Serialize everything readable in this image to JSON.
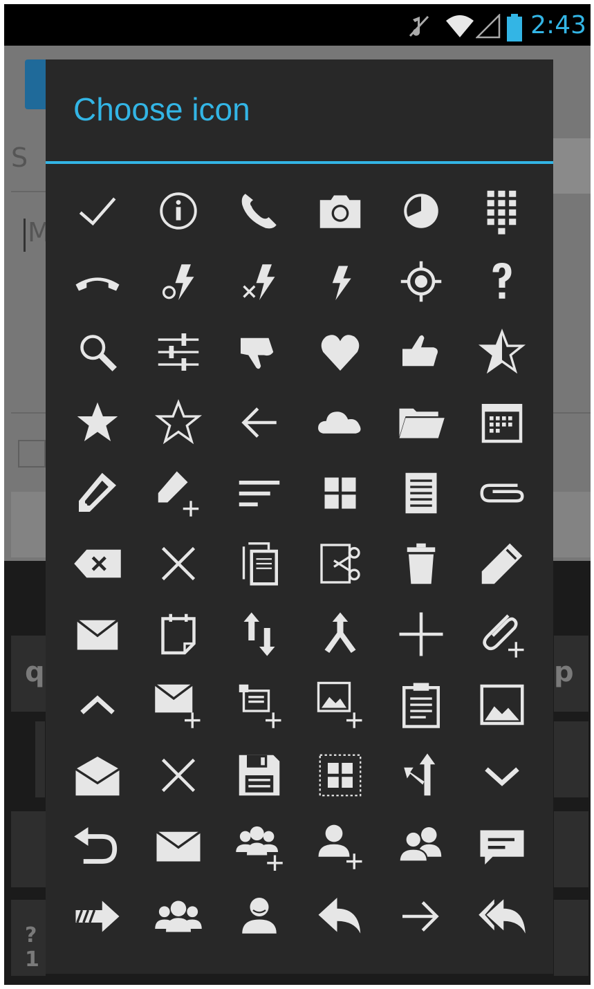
{
  "status_bar": {
    "time": "2:43",
    "icons": [
      "mute-icon",
      "wifi-icon",
      "signal-icon",
      "battery-icon"
    ],
    "accent_color": "#33b5e5"
  },
  "background_app": {
    "search_hint_letter": "S",
    "field_letter": "M",
    "keyboard_keys": [
      "q",
      "p",
      "?1"
    ]
  },
  "dialog": {
    "title": "Choose icon",
    "title_color": "#33b5e5",
    "background": "#282828",
    "icons": [
      "checkmark-icon",
      "info-icon",
      "phone-icon",
      "camera-icon",
      "clock-icon",
      "dialpad-icon",
      "end-call-icon",
      "flash-auto-icon",
      "flash-off-icon",
      "flash-icon",
      "locate-icon",
      "help-icon",
      "search-icon",
      "settings-sliders-icon",
      "thumbs-down-icon",
      "heart-icon",
      "thumbs-up-icon",
      "half-star-icon",
      "star-filled-icon",
      "star-outline-icon",
      "back-arrow-icon",
      "cloud-icon",
      "folder-icon",
      "calendar-icon",
      "label-icon",
      "add-label-icon",
      "sort-icon",
      "grid-view-icon",
      "document-icon",
      "attachment-icon",
      "backspace-icon",
      "close-icon",
      "copy-icon",
      "cut-icon",
      "trash-icon",
      "edit-icon",
      "email-icon",
      "new-event-icon",
      "sort-by-size-icon",
      "merge-icon",
      "add-icon",
      "add-attachment-icon",
      "collapse-icon",
      "new-email-icon",
      "add-to-queue-icon",
      "add-picture-icon",
      "paste-icon",
      "picture-icon",
      "open-envelope-icon",
      "remove-icon",
      "save-icon",
      "select-all-icon",
      "split-icon",
      "expand-icon",
      "undo-icon",
      "envelope-icon",
      "add-group-icon",
      "add-person-icon",
      "people-icon",
      "chat-icon",
      "forward-icon",
      "group-icon",
      "person-icon",
      "reply-icon",
      "next-icon",
      "reply-all-icon"
    ]
  }
}
